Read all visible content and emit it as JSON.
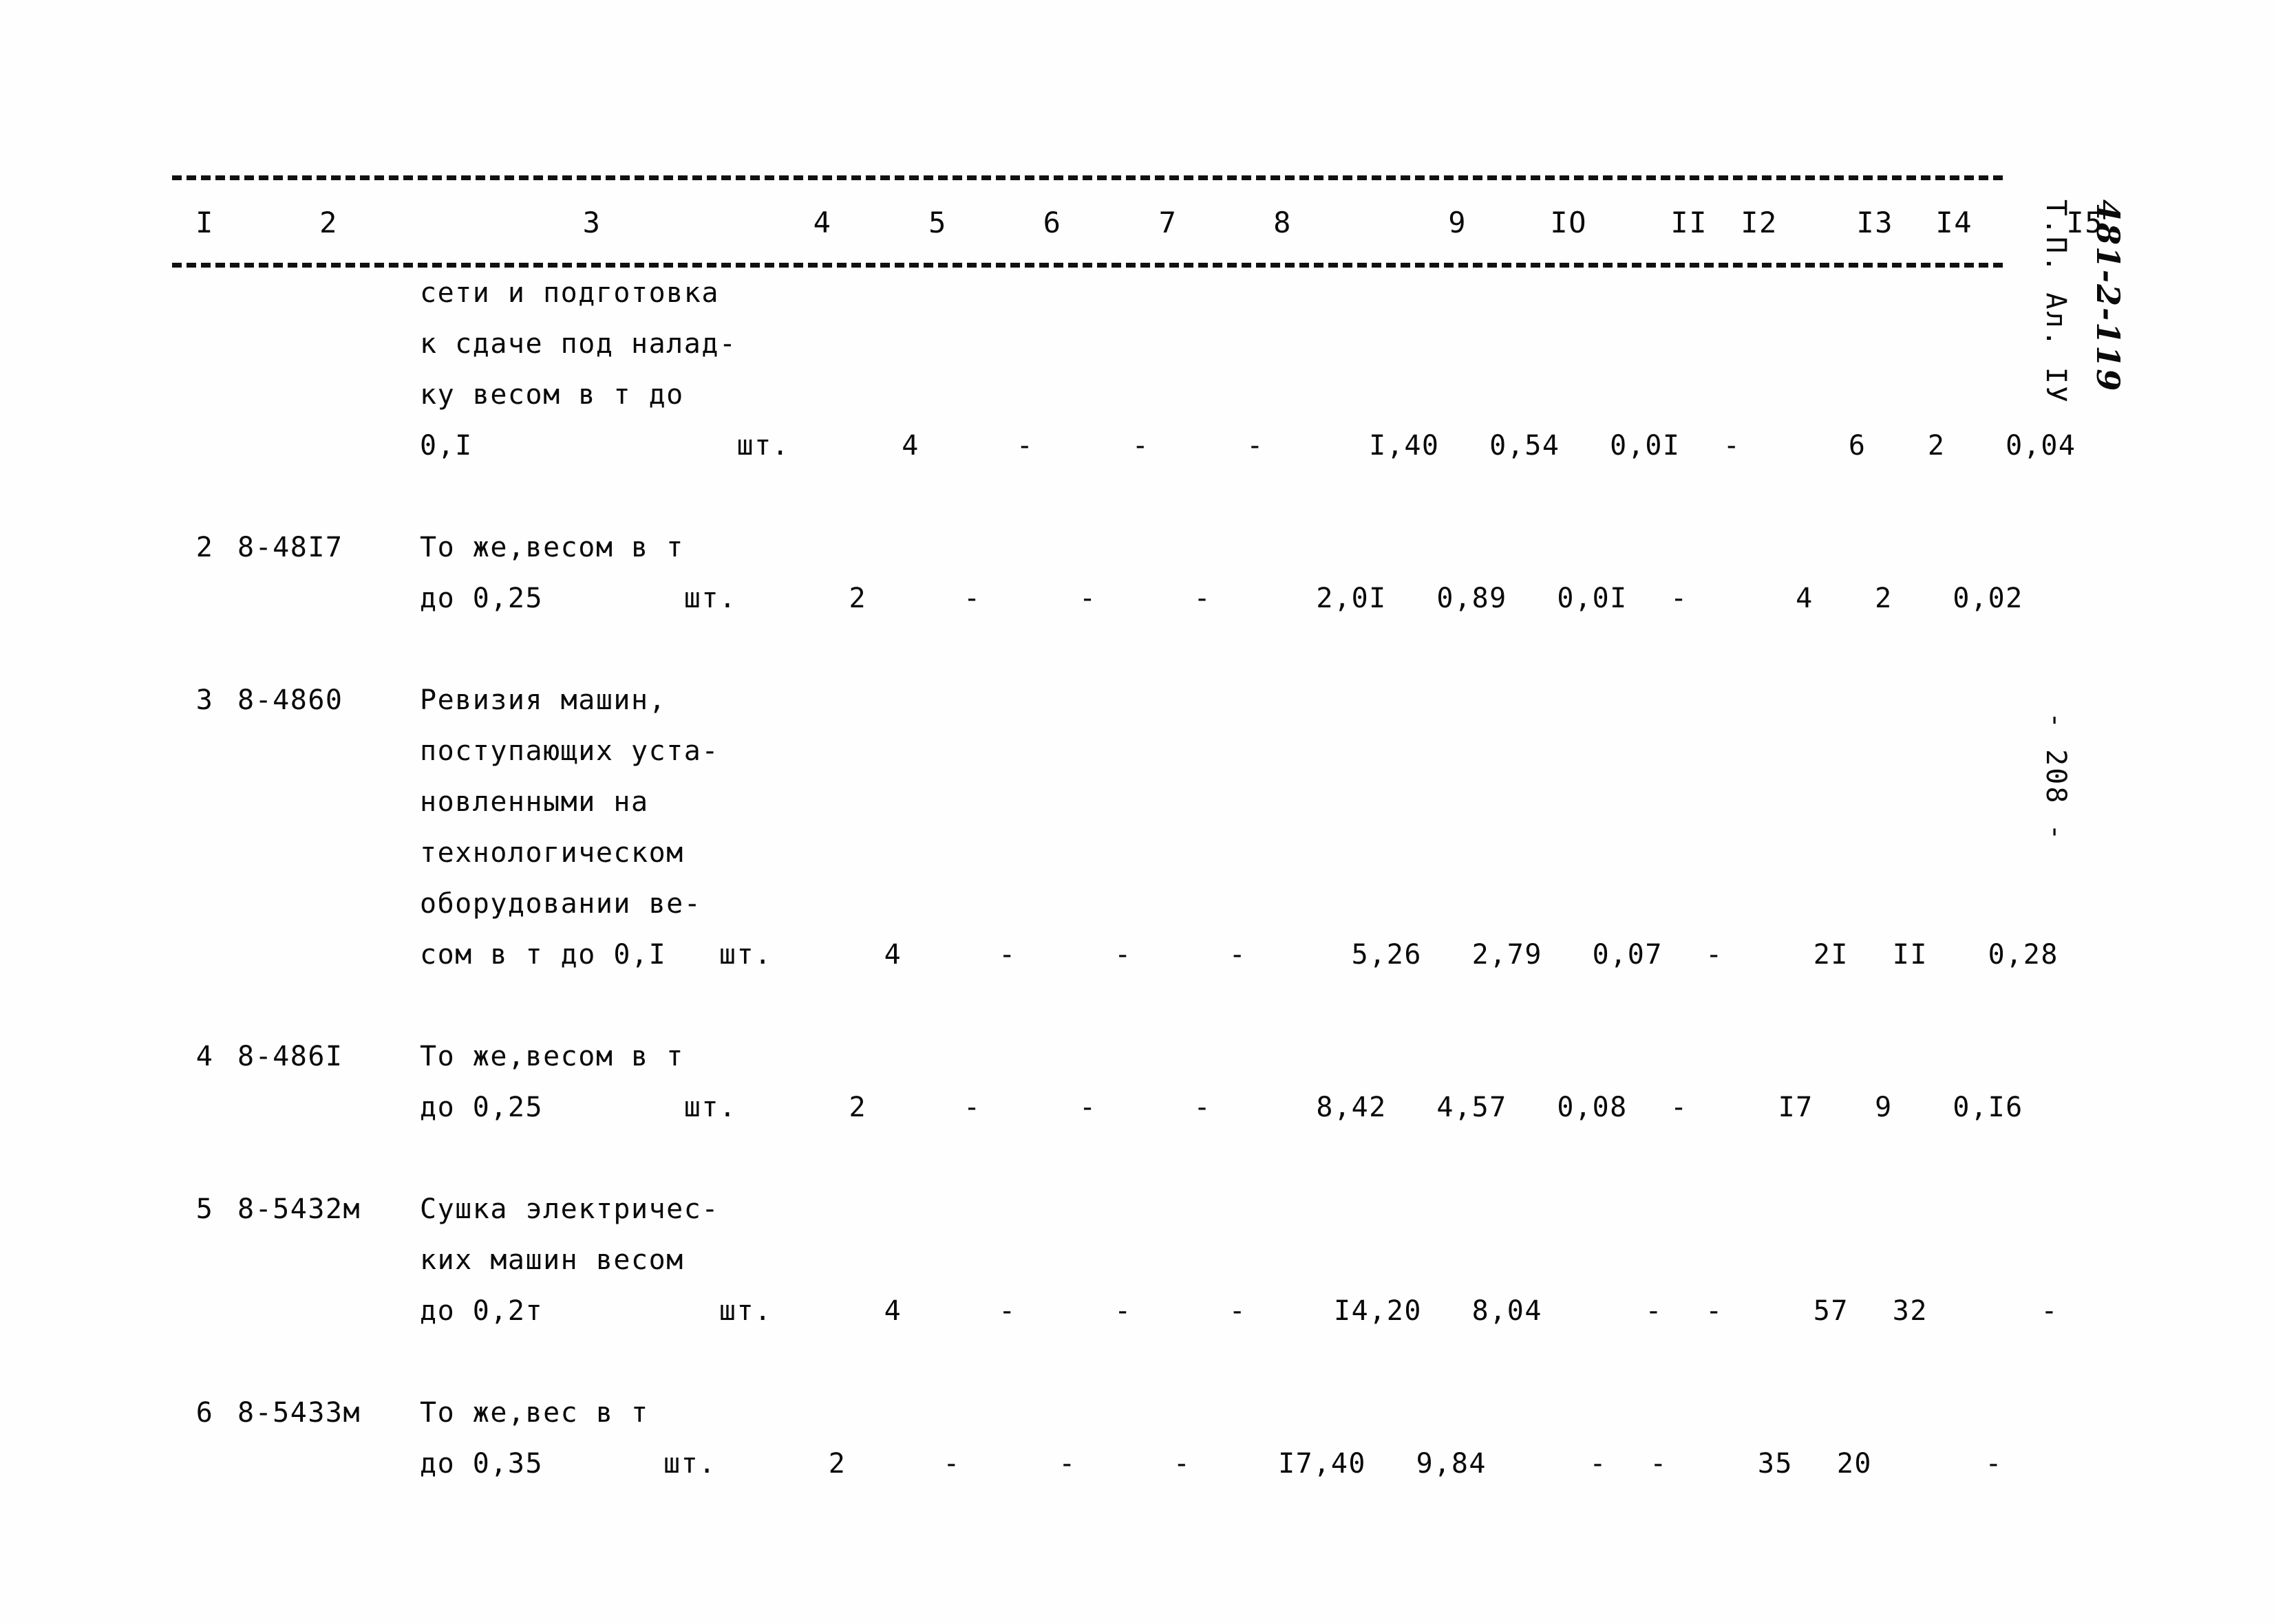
{
  "document": {
    "margin_code": "481-2-119",
    "margin_album": "Т.П. Ал. IУ",
    "page_number": "- 208 -"
  },
  "table": {
    "column_headers": [
      "I",
      "2",
      "3",
      "4",
      "5",
      "6",
      "7",
      "8",
      "9",
      "IO",
      "II",
      "I2",
      "I3",
      "I4",
      "I5"
    ],
    "rows": [
      {
        "num": "",
        "code": "",
        "desc_lines": [
          "сети и подготовка",
          "к сдаче под налад-",
          "ку весом в т до",
          "0,I"
        ],
        "unit": "шт.",
        "qty": "4",
        "c6": "-",
        "c7": "-",
        "c8": "-",
        "c9": "I,40",
        "c10": "0,54",
        "c11": "0,0I",
        "c12": "-",
        "c13": "6",
        "c14": "2",
        "c15": "0,04"
      },
      {
        "num": "2",
        "code": "8-48I7",
        "desc_lines": [
          "То же,весом в т",
          "до 0,25"
        ],
        "unit": "шт.",
        "qty": "2",
        "c6": "-",
        "c7": "-",
        "c8": "-",
        "c9": "2,0I",
        "c10": "0,89",
        "c11": "0,0I",
        "c12": "-",
        "c13": "4",
        "c14": "2",
        "c15": "0,02"
      },
      {
        "num": "З",
        "code": "8-4860",
        "desc_lines": [
          "Ревизия машин,",
          "поступающих уста-",
          "новленными на",
          "технологическом",
          "оборудовании ве-",
          "сом в т до 0,I"
        ],
        "unit": "шт.",
        "qty": "4",
        "c6": "-",
        "c7": "-",
        "c8": "-",
        "c9": "5,26",
        "c10": "2,79",
        "c11": "0,07",
        "c12": "-",
        "c13": "2I",
        "c14": "II",
        "c15": "0,28"
      },
      {
        "num": "4",
        "code": "8-486I",
        "desc_lines": [
          "То же,весом в т",
          "до 0,25"
        ],
        "unit": "шт.",
        "qty": "2",
        "c6": "-",
        "c7": "-",
        "c8": "-",
        "c9": "8,42",
        "c10": "4,57",
        "c11": "0,08",
        "c12": "-",
        "c13": "I7",
        "c14": "9",
        "c15": "0,I6"
      },
      {
        "num": "5",
        "code": "8-5432м",
        "desc_lines": [
          "Сушка электричес-",
          "ких машин весом",
          "до 0,2т"
        ],
        "unit": "шт.",
        "qty": "4",
        "c6": "-",
        "c7": "-",
        "c8": "-",
        "c9": "I4,20",
        "c10": "8,04",
        "c11": "-",
        "c12": "-",
        "c13": "57",
        "c14": "32",
        "c15": "-"
      },
      {
        "num": "6",
        "code": "8-5433м",
        "desc_lines": [
          "То же,вес в т",
          "до 0,35"
        ],
        "unit": "шт.",
        "qty": "2",
        "c6": "-",
        "c7": "-",
        "c8": "-",
        "c9": "I7,40",
        "c10": "9,84",
        "c11": "-",
        "c12": "-",
        "c13": "35",
        "c14": "20",
        "c15": "-"
      }
    ]
  }
}
